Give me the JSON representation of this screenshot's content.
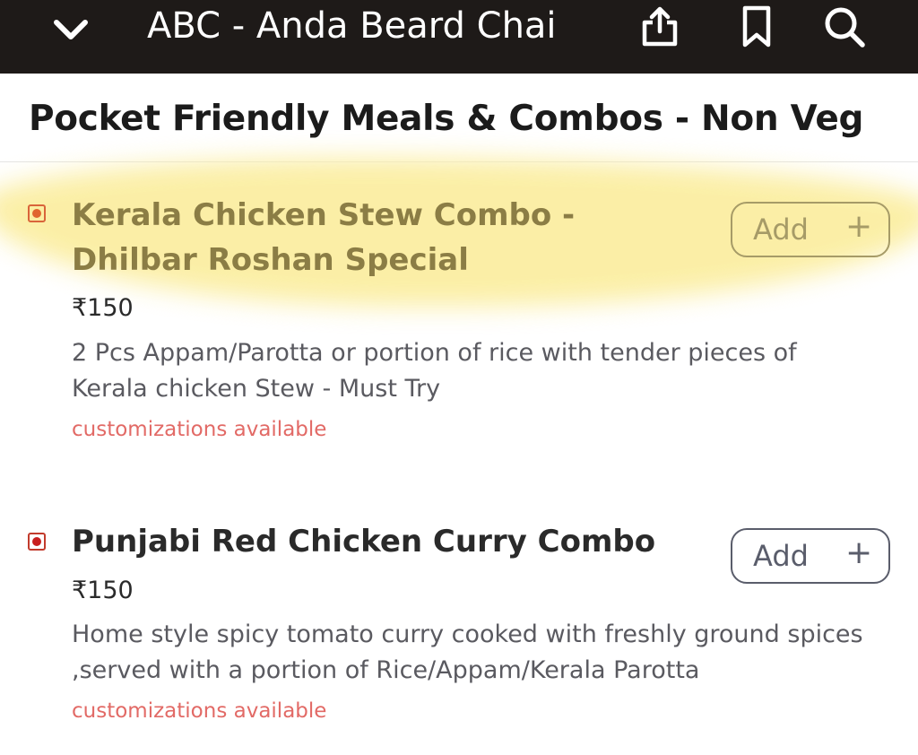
{
  "header": {
    "title": "ABC - Anda Beard Chai",
    "back_icon": "chevron-down-icon",
    "share_icon": "share-icon",
    "bookmark_icon": "bookmark-icon",
    "search_icon": "search-icon"
  },
  "section": {
    "title": "Pocket Friendly Meals & Combos - Non Veg"
  },
  "items": [
    {
      "name": "Kerala Chicken Stew Combo - Dhilbar Roshan Special",
      "price": "₹150",
      "description": "2 Pcs Appam/Parotta or portion of rice with tender pieces of Kerala chicken Stew - Must Try",
      "customizations": "customizations available",
      "add_label": "Add",
      "add_plus": "+",
      "highlighted": true
    },
    {
      "name": "Punjabi Red Chicken Curry Combo",
      "price": "₹150",
      "description": "Home style spicy tomato curry cooked with freshly ground spices ,served with a portion of Rice/Appam/Kerala Parotta",
      "customizations": "customizations available",
      "add_label": "Add",
      "add_plus": "+",
      "highlighted": false
    }
  ],
  "colors": {
    "header_bg": "#1e1a18",
    "highlight": "#fbeea2",
    "nonveg_mark": "#c81f1f",
    "customization_text": "#e26a66"
  }
}
